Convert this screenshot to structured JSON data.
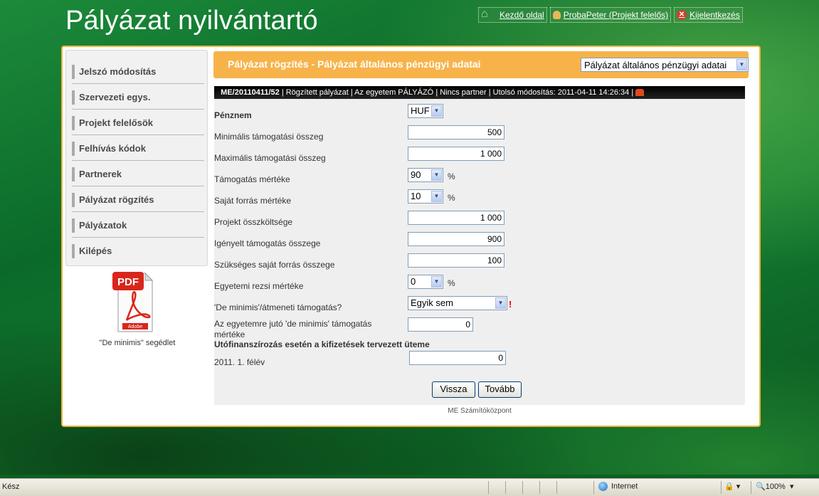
{
  "app": {
    "title": "Pályázat nyilvántartó"
  },
  "toplinks": {
    "home": "Kezdő oldal",
    "user": "ProbaPeter (Projekt felelős)",
    "logout": "Kijelentkezés"
  },
  "sidebar": {
    "items": [
      {
        "label": "Jelszó módosítás"
      },
      {
        "label": "Szervezeti egys."
      },
      {
        "label": "Projekt felelősök"
      },
      {
        "label": "Felhívás kódok"
      },
      {
        "label": "Partnerek"
      },
      {
        "label": "Pályázat rögzítés"
      },
      {
        "label": "Pályázatok"
      },
      {
        "label": "Kilépés"
      }
    ],
    "pdf_caption": "\"De minimis\" segédlet",
    "pdf_label": "PDF",
    "pdf_brand": "Adobe"
  },
  "header": {
    "title": "Pályázat rögzítés - Pályázat általános pénzügyi adatai",
    "select_value": "Pályázat általános pénzügyi adatai"
  },
  "status": {
    "id": "ME/20110411/52",
    "state": "Rögzített pályázat",
    "applicant": "Az egyetem PÁLYÁZÓ",
    "partner": "Nincs partner",
    "modified": "Utolsó módosítás: 2011-04-11 14:26:34"
  },
  "form": {
    "currency": {
      "label": "Pénznem",
      "value": "HUF"
    },
    "min_support": {
      "label": "Minimális támogatási összeg",
      "value": "500"
    },
    "max_support": {
      "label": "Maximális támogatási összeg",
      "value": "1 000"
    },
    "support_rate": {
      "label": "Támogatás mértéke",
      "value": "90",
      "unit": "%"
    },
    "own_rate": {
      "label": "Saját forrás mértéke",
      "value": "10",
      "unit": "%"
    },
    "total_cost": {
      "label": "Projekt összköltsége",
      "value": "1 000"
    },
    "requested": {
      "label": "Igényelt támogatás összege",
      "value": "900"
    },
    "own_amount": {
      "label": "Szükséges saját forrás összege",
      "value": "100"
    },
    "overhead": {
      "label": "Egyetemi rezsi mértéke",
      "value": "0",
      "unit": "%"
    },
    "deminimis": {
      "label": "'De minimis'/átmeneti támogatás?",
      "value": "Egyik sem",
      "warn": "!"
    },
    "univ_deminimis": {
      "label_line1": "Az egyetemre jutó 'de minimis' támogatás",
      "label_line2": "mértéke",
      "value": "0"
    },
    "postfin_title": "Utófinanszírozás esetén a kifizetések tervezett üteme",
    "semester": {
      "label": "2011. 1. félév",
      "value": "0"
    },
    "back_button": "Vissza",
    "next_button": "Tovább"
  },
  "footer": "ME Számítóközpont",
  "browser": {
    "status_left": "Kész",
    "zone": "Internet",
    "zoom": "100%"
  }
}
